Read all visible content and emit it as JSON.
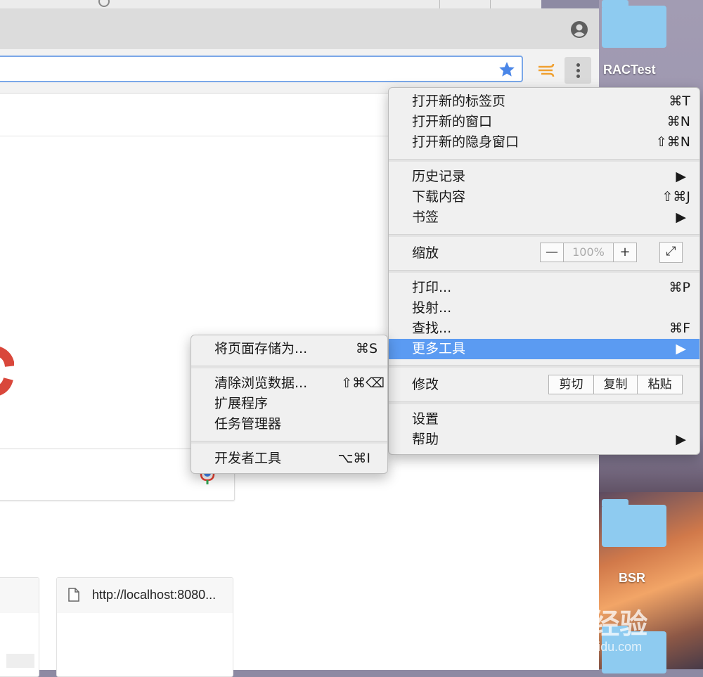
{
  "desktop": {
    "items": [
      {
        "label": "RACTest",
        "icon": "folder-icon"
      },
      {
        "label": "BSR",
        "icon": "folder-icon"
      }
    ],
    "watermark": {
      "brand": "Bai  经验",
      "url": "jingyan.baidu.com"
    }
  },
  "browser": {
    "titlebar": {
      "profile_icon": "profile-icon"
    },
    "toolbar": {
      "bookmark_icon": "star-icon",
      "extension_icon": "wind-extension-icon",
      "menu_icon": "more-vertical-icon"
    },
    "tiles": [
      {
        "title": ""
      },
      {
        "title": "http://localhost:8080..."
      }
    ]
  },
  "main_menu": {
    "items": [
      {
        "label": "打开新的标签页",
        "shortcut": "⌘T"
      },
      {
        "label": "打开新的窗口",
        "shortcut": "⌘N"
      },
      {
        "label": "打开新的隐身窗口",
        "shortcut": "⇧⌘N"
      },
      {
        "label": "历史记录",
        "shortcut": "▶"
      },
      {
        "label": "下载内容",
        "shortcut": "⇧⌘J"
      },
      {
        "label": "书签",
        "shortcut": "▶"
      },
      {
        "label": "打印...",
        "shortcut": "⌘P"
      },
      {
        "label": "投射...",
        "shortcut": ""
      },
      {
        "label": "查找...",
        "shortcut": "⌘F"
      },
      {
        "label": "更多工具",
        "shortcut": "▶"
      },
      {
        "label": "设置",
        "shortcut": ""
      },
      {
        "label": "帮助",
        "shortcut": "▶"
      }
    ],
    "zoom": {
      "label": "缩放",
      "minus": "—",
      "value": "100%",
      "plus": "+",
      "fullscreen": "⤢"
    },
    "edit": {
      "label": "修改",
      "cut": "剪切",
      "copy": "复制",
      "paste": "粘贴"
    },
    "highlight_color": "#5b9bf2"
  },
  "submenu": {
    "items": [
      {
        "label": "将页面存储为...",
        "shortcut": "⌘S"
      },
      {
        "label": "清除浏览数据...",
        "shortcut": "⇧⌘⌫"
      },
      {
        "label": "扩展程序",
        "shortcut": ""
      },
      {
        "label": "任务管理器",
        "shortcut": ""
      },
      {
        "label": "开发者工具",
        "shortcut": "⌥⌘I"
      }
    ]
  }
}
